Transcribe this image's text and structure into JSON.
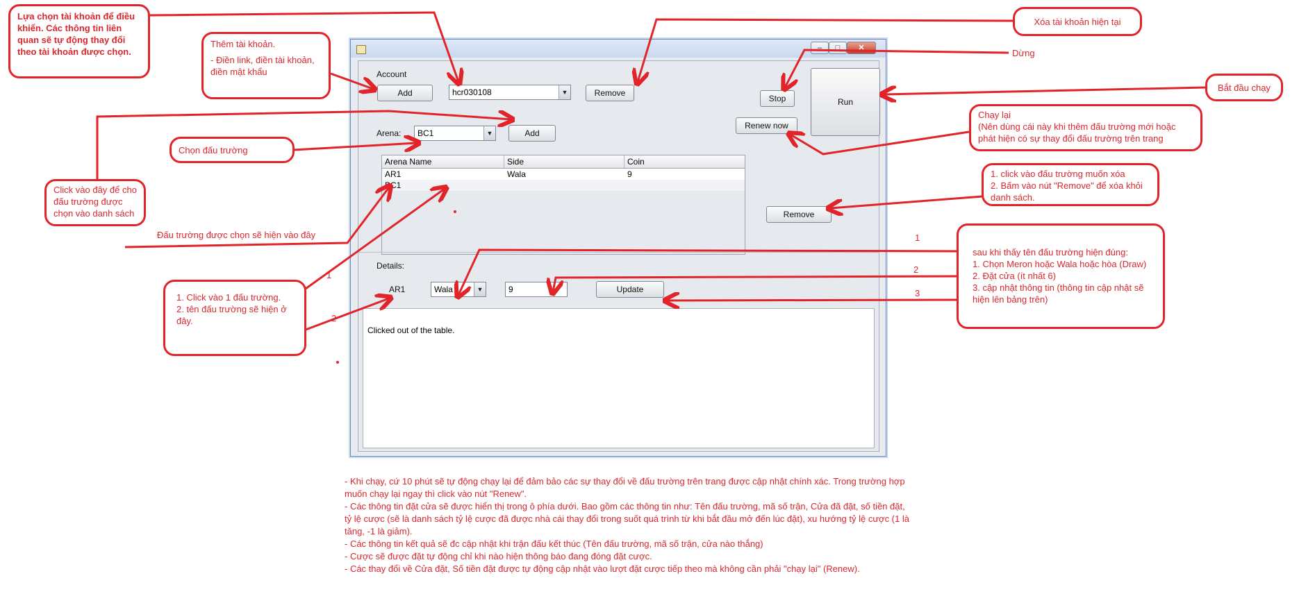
{
  "window": {
    "controls": {
      "minimize": "–",
      "maximize": "□",
      "close": "✕"
    }
  },
  "account": {
    "label": "Account",
    "add_button": "Add",
    "selected": "hcr030108",
    "remove_button": "Remove"
  },
  "controls": {
    "stop_button": "Stop",
    "run_button": "Run",
    "renew_button": "Renew now"
  },
  "arena": {
    "label": "Arena:",
    "selected": "BC1",
    "add_button": "Add"
  },
  "table": {
    "columns": [
      "Arena Name",
      "Side",
      "Coin"
    ],
    "rows": [
      {
        "name": "AR1",
        "side": "Wala",
        "coin": "9"
      },
      {
        "name": "BC1",
        "side": "",
        "coin": ""
      }
    ]
  },
  "table_remove_button": "Remove",
  "details": {
    "label": "Details:",
    "arena_name": "AR1",
    "side_selected": "Wala",
    "amount": "9",
    "update_button": "Update"
  },
  "log": {
    "text": "Clicked out of the table."
  },
  "annotations": {
    "choose_account": "Lựa chọn tài khoản để điều khiển. Các thông tin liên quan sẽ tự động thay đổi theo tài khoản được chọn.",
    "add_account_title": "Thêm tài khoản.",
    "add_account_body": "- Điền link, điền tài khoản, điền mật khẩu",
    "remove_account": "Xóa tài khoản hiện tại",
    "stop": "Dừng",
    "start": "Bắt đầu chạy",
    "renew_title": "Chạy lại",
    "renew_body": "(Nên dùng cái này khi thêm đấu trường mới hoặc phát hiện có sự thay đổi đấu trường trên trang",
    "choose_arena": "Chọn đấu trường",
    "click_add_arena": "Click vào đây để cho đấu trường được chọn vào danh sách",
    "arena_shown": "Đấu trường được chọn sẽ hiện vào đây",
    "remove_arena_1": "1. click vào đấu trường muốn xóa",
    "remove_arena_2": "2. Bấm vào nút \"Remove\" để xóa khỏi danh sách.",
    "details_steps_1": "1. Click vào 1 đấu trường.",
    "details_steps_2": "2. tên đấu trường sẽ hiện ở đây.",
    "num1": "1",
    "num2": "2",
    "num1b": "1",
    "num2b": "2",
    "num3b": "3",
    "after_see_title": "sau khi thấy tên đấu trường hiện đúng:",
    "after_see_1": "1. Chọn Meron hoặc Wala hoặc hòa (Draw)",
    "after_see_2": "2. Đặt cửa (ít nhất 6)",
    "after_see_3": "3. cập nhật thông tin (thông tin cập nhật sẽ hiện lên bảng trên)"
  },
  "bottom_notes": [
    "- Khi chạy, cứ 10 phút sẽ tự động chạy lại để đảm bảo các sự thay đổi về đấu trường trên trang được cập nhật chính xác. Trong trường hợp muốn chạy lại ngay thì click vào nút \"Renew\".",
    "- Các thông tin đặt cửa sẽ được hiển thị trong ô phía dưới. Bao gồm các thông tin như: Tên đấu trường, mã số trận, Cửa đã đặt, số tiền đặt, tỷ lệ cược (sẽ là danh sách tỷ lệ cược đã được nhà cái thay đổi trong suốt quá trình từ khi bắt đầu mở đến lúc đặt), xu hướng tỷ lệ cược (1 là tăng, -1 là giảm).",
    "- Các thông tin kết quả sẽ đc cập nhật khi trận đấu kết thúc (Tên đấu trường, mã số trận, cửa nào thắng)",
    "- Cược sẽ được đặt tự động chỉ khi nào hiện thông báo đang đóng đặt cược.",
    "- Các thay đổi về Cửa đặt, Số tiền đặt được tự động cập nhật vào lượt đặt cược tiếp theo mà không cần phải \"chạy lại\" (Renew)."
  ],
  "colors": {
    "annotation": "#d8272d",
    "window_bg": "#e6e9ee"
  }
}
